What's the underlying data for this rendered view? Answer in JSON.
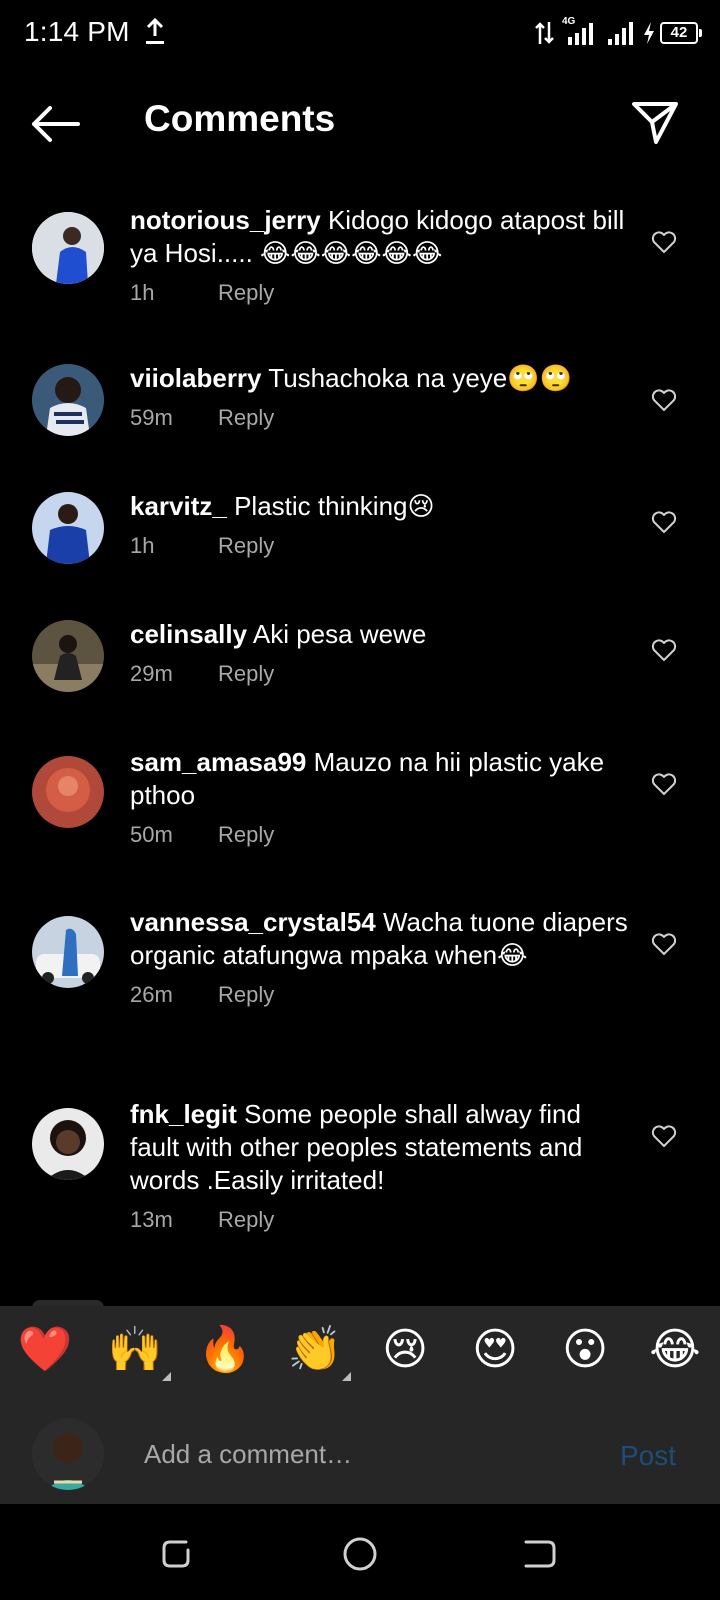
{
  "status_bar": {
    "time": "1:14 PM",
    "network": "4G",
    "battery": "42"
  },
  "header": {
    "title": "Comments"
  },
  "comments": [
    {
      "username": "notorious_jerry",
      "text": "Kidogo kidogo atapost bill ya Hosi..... 😂😂😂😂😂😂",
      "time": "1h",
      "reply": "Reply"
    },
    {
      "username": "viiolaberry",
      "text": "Tushachoka na yeye🙄🙄",
      "time": "59m",
      "reply": "Reply"
    },
    {
      "username": "karvitz_",
      "text": "Plastic thinking😢",
      "time": "1h",
      "reply": "Reply"
    },
    {
      "username": "celinsally",
      "text": "Aki pesa wewe",
      "time": "29m",
      "reply": "Reply"
    },
    {
      "username": "sam_amasa99",
      "text": "Mauzo na hii plastic yake pthoo",
      "time": "50m",
      "reply": "Reply"
    },
    {
      "username": "vannessa_crystal54",
      "text": "Wacha tuone diapers organic atafungwa mpaka when😂",
      "time": "26m",
      "reply": "Reply"
    },
    {
      "username": "fnk_legit",
      "text": "Some people shall alway find fault with other peoples statements and words .Easily irritated!",
      "time": "13m",
      "reply": "Reply"
    }
  ],
  "emoji_bar": [
    "❤️",
    "🙌",
    "🔥",
    "👏",
    "😢",
    "😍",
    "😮",
    "😂"
  ],
  "composer": {
    "placeholder": "Add a comment…",
    "post_label": "Post"
  },
  "colors": {
    "background": "#000000",
    "bar": "#262626",
    "secondary_text": "#a8a8a8",
    "post_disabled": "#1e4d7a"
  }
}
